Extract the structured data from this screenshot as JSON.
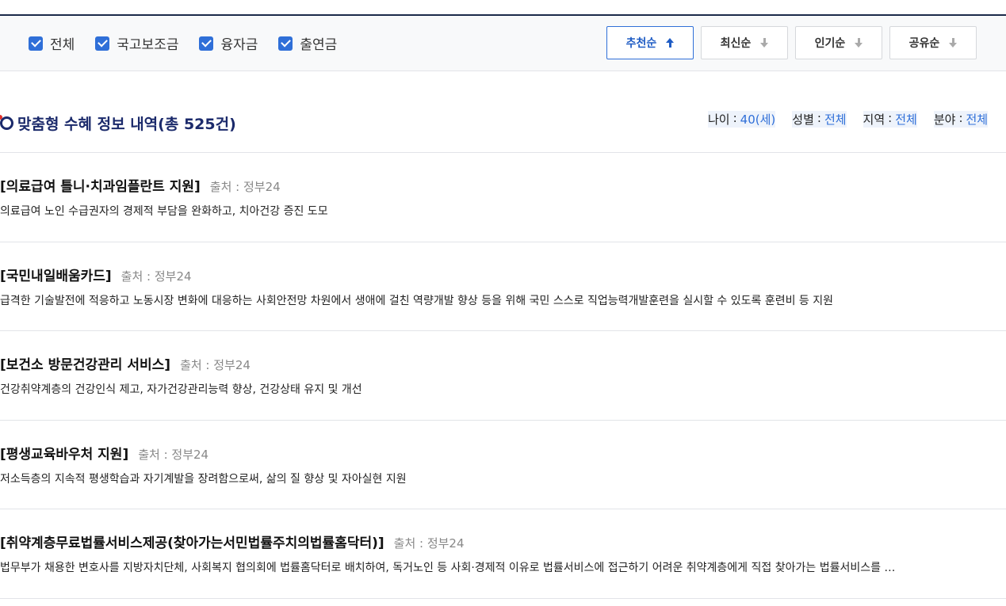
{
  "filters": [
    {
      "label": "전체",
      "checked": true
    },
    {
      "label": "국고보조금",
      "checked": true
    },
    {
      "label": "융자금",
      "checked": true
    },
    {
      "label": "출연금",
      "checked": true
    }
  ],
  "sort": {
    "options": [
      {
        "label": "추천순",
        "active": true,
        "icon": "arrow-up-icon"
      },
      {
        "label": "최신순",
        "active": false,
        "icon": "arrow-down-icon"
      },
      {
        "label": "인기순",
        "active": false,
        "icon": "arrow-down-icon"
      },
      {
        "label": "공유순",
        "active": false,
        "icon": "arrow-down-icon"
      }
    ]
  },
  "section": {
    "title": "맞춤형 수혜 정보 내역(총 525건)"
  },
  "meta": {
    "sep": ":",
    "items": [
      {
        "key": "나이",
        "value": "40(세)"
      },
      {
        "key": "성별",
        "value": "전체"
      },
      {
        "key": "지역",
        "value": "전체"
      },
      {
        "key": "분야",
        "value": "전체"
      }
    ]
  },
  "results": [
    {
      "name": "[의료급여 틀니·치과임플란트 지원]",
      "source": "출처 : 정부24",
      "desc": "의료급여 노인 수급권자의 경제적 부담을 완화하고, 치아건강 증진 도모"
    },
    {
      "name": "[국민내일배움카드]",
      "source": "출처 : 정부24",
      "desc": "급격한 기술발전에 적응하고 노동시장 변화에 대응하는 사회안전망 차원에서 생애에 걸친 역량개발 향상 등을 위해 국민 스스로 직업능력개발훈련을 실시할 수 있도록 훈련비 등 지원"
    },
    {
      "name": "[보건소 방문건강관리 서비스]",
      "source": "출처 : 정부24",
      "desc": "건강취약계층의 건강인식 제고, 자가건강관리능력 향상, 건강상태 유지 및 개선"
    },
    {
      "name": "[평생교육바우처 지원]",
      "source": "출처 : 정부24",
      "desc": "저소득층의 지속적 평생학습과 자기계발을 장려함으로써, 삶의 질 향상 및 자아실현 지원"
    },
    {
      "name": "[취약계층무료법률서비스제공(찾아가는서민법률주치의법률홈닥터)]",
      "source": "출처 : 정부24",
      "desc": "법무부가 채용한 변호사를 지방자치단체, 사회복지 협의회에 법률홈닥터로 배치하여, 독거노인 등 사회·경제적 이유로 법률서비스에 접근하기 어려운 취약계층에게 직접 찾아가는 법률서비스를 …"
    }
  ]
}
